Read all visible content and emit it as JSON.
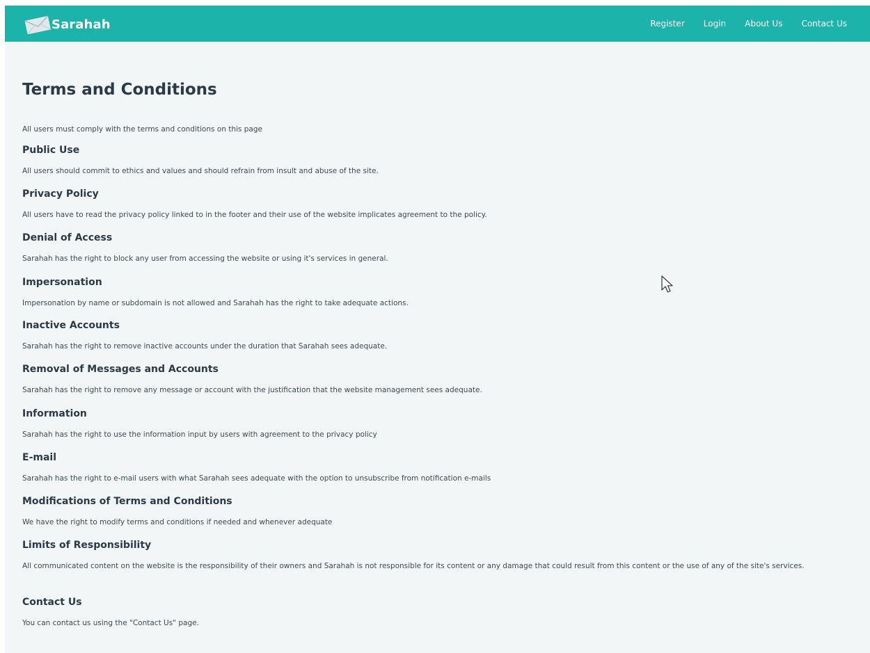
{
  "brand": {
    "name": "Sarahah",
    "accent_color": "#1bb3aa",
    "logo_icon": "envelope-logo-icon"
  },
  "nav": {
    "items": [
      {
        "label": "Register"
      },
      {
        "label": "Login"
      },
      {
        "label": "About Us"
      },
      {
        "label": "Contact Us"
      }
    ]
  },
  "page": {
    "title": "Terms and Conditions",
    "intro": "All users must comply with the terms and conditions on this page"
  },
  "sections": [
    {
      "title": "Public Use",
      "text": "All users should commit to ethics and values and should refrain from insult and abuse of the site."
    },
    {
      "title": "Privacy Policy",
      "text": "All users have to read the privacy policy linked to in the footer and their use of the website implicates agreement to the policy."
    },
    {
      "title": "Denial of Access",
      "text": "Sarahah has the right to block any user from accessing the website or using it's services in general."
    },
    {
      "title": "Impersonation",
      "text": "Impersonation by name or subdomain is not allowed and Sarahah has the right to take adequate actions."
    },
    {
      "title": "Inactive Accounts",
      "text": "Sarahah has the right to remove inactive accounts under the duration that Sarahah sees adequate."
    },
    {
      "title": "Removal of Messages and Accounts",
      "text": "Sarahah has the right to remove any message or account with the justification that the website management sees adequate."
    },
    {
      "title": "Information",
      "text": "Sarahah has the right to use the information input by users with agreement to the privacy policy"
    },
    {
      "title": "E-mail",
      "text": "Sarahah has the right to e-mail users with what Sarahah sees adequate with the option to unsubscribe from notification e-mails"
    },
    {
      "title": "Modifications of Terms and Conditions",
      "text": "We have the right to modify terms and conditions if needed and whenever adequate"
    },
    {
      "title": "Limits of Responsibility",
      "text": "All communicated content on the website is the responsibility of their owners and Sarahah is not responsible for its content or any damage that could result from this content or the use of any of the site's services."
    },
    {
      "title": "Contact Us",
      "text": "You can contact us using the \"Contact Us\" page."
    }
  ]
}
